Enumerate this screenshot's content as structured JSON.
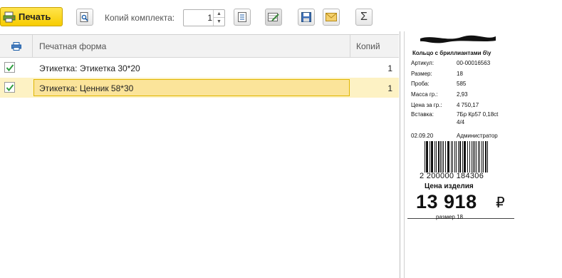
{
  "toolbar": {
    "print_label": "Печать",
    "copies_label": "Копий комплекта:",
    "copies_value": "1"
  },
  "table": {
    "columns": {
      "name": "Печатная форма",
      "copies": "Копий"
    },
    "rows": [
      {
        "name": "Этикетка: Этикетка 30*20",
        "copies": "1",
        "checked": true,
        "selected": false
      },
      {
        "name": "Этикетка: Ценник 58*30",
        "copies": "1",
        "checked": true,
        "selected": true
      }
    ]
  },
  "preview": {
    "title": "Кольцо с бриллиантами б\\у",
    "fields": [
      {
        "key": "Артикул:",
        "value": "00-00016563"
      },
      {
        "key": "Размер:",
        "value": "18"
      },
      {
        "key": "Проба:",
        "value": "585"
      },
      {
        "key": "Масса гр.:",
        "value": "2,93"
      },
      {
        "key": "Цена за гр.:",
        "value": "4 750,17"
      },
      {
        "key": "Вставка:",
        "value": "7Бр Кр57 0,18ct"
      },
      {
        "key": "",
        "value": "4/4"
      },
      {
        "key": "02.09.20",
        "value": "Администратор"
      }
    ],
    "barcode_digits": "2 200000 184306",
    "price_label": "Цена изделия",
    "price": "13 918",
    "currency": "₽",
    "size_note": "размер 18"
  },
  "colors": {
    "accent": "#f7cc00",
    "selection": "#fbe49a",
    "check": "#2e9e3e"
  }
}
